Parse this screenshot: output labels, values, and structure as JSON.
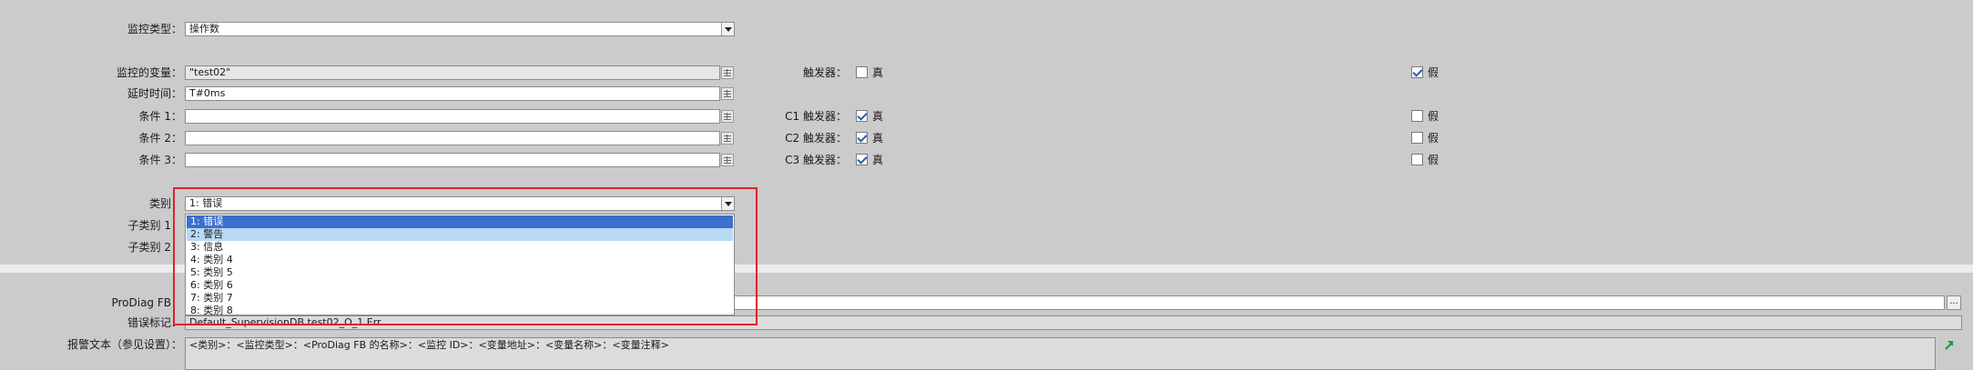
{
  "form": {
    "monitor_type": {
      "label": "监控类型：",
      "value": "操作数"
    },
    "monitored_tag": {
      "label": "监控的变量：",
      "value": "\"test02\""
    },
    "delay": {
      "label": "延时时间：",
      "value": "T#0ms"
    },
    "cond1": {
      "label": "条件 1：",
      "value": ""
    },
    "cond2": {
      "label": "条件 2：",
      "value": ""
    },
    "cond3": {
      "label": "条件 3：",
      "value": ""
    },
    "category": {
      "label": "类别：",
      "value": "1: 错误"
    },
    "subcategory1": {
      "label": "子类别 1："
    },
    "subcategory2": {
      "label": "子类别 2："
    }
  },
  "triggers": {
    "main": {
      "label": "触发器：",
      "true_label": "真",
      "true_checked": false,
      "false_label": "假",
      "false_checked": true
    },
    "c1": {
      "label": "C1 触发器：",
      "true_label": "真",
      "true_checked": true,
      "false_label": "假",
      "false_checked": false
    },
    "c2": {
      "label": "C2 触发器：",
      "true_label": "真",
      "true_checked": true,
      "false_label": "假",
      "false_checked": false
    },
    "c3": {
      "label": "C3 触发器：",
      "true_label": "真",
      "true_checked": true,
      "false_label": "假",
      "false_checked": false
    }
  },
  "category_dropdown": {
    "options": [
      "1: 错误",
      "2: 警告",
      "3: 信息",
      "4: 类别 4",
      "5: 类别 5",
      "6: 类别 6",
      "7: 类别 7",
      "8: 类别 8"
    ],
    "selected_index": 0,
    "hover_index": 1
  },
  "bottom": {
    "prodiag_fb": {
      "label": "ProDiag FB：",
      "value": "",
      "browse_label": "..."
    },
    "error_tag": {
      "label": "错误标记：",
      "value": "Default_SupervisionDB.test02_O_1.Err"
    },
    "alarm_text": {
      "label": "报警文本（参见设置）：",
      "value": "<类别>：<监控类型>：<ProDiag FB 的名称>：<监控 ID>：<变量地址>：<变量名称>：<变量注释>"
    }
  },
  "colors": {
    "highlight_box": "#e0212b",
    "selected_option": "#3d6fcc",
    "hover_option": "#b7daf5",
    "checkbox_check": "#2a5db0"
  },
  "icons": {
    "tag_browse": "tag-list-icon",
    "dropdown": "chevron-down-icon",
    "link_arrow": "green-arrow-up-right-icon"
  }
}
